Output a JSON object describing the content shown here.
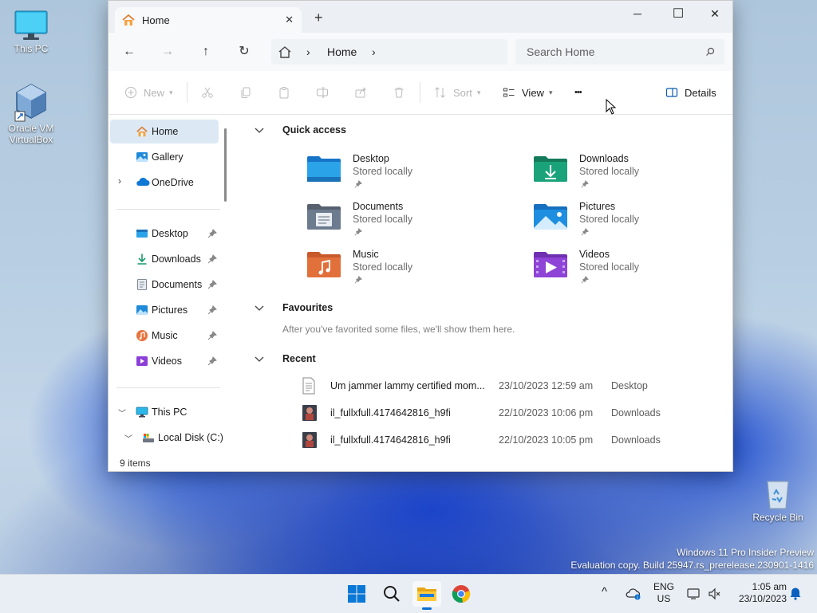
{
  "desktop": {
    "icons": [
      {
        "label": "This PC"
      },
      {
        "label": "Oracle VM VirtualBox"
      },
      {
        "label": "Recycle Bin"
      }
    ],
    "watermark": {
      "line1": "Windows 11 Pro Insider Preview",
      "line2": "Evaluation copy. Build 25947.rs_prerelease.230901-1416"
    }
  },
  "window": {
    "tab": {
      "title": "Home",
      "close": "✕"
    },
    "new_tab": "+",
    "controls": {
      "minimize": "─",
      "maximize": "☐",
      "close": "✕"
    },
    "nav": {
      "back": "←",
      "forward": "→",
      "up": "↑",
      "refresh": "↻"
    },
    "breadcrumb": {
      "home_icon": "home-icon",
      "separator": "›",
      "current": "Home"
    },
    "search": {
      "placeholder": "Search Home"
    },
    "toolbar": {
      "new": "New",
      "sort": "Sort",
      "view": "View",
      "more": "•••",
      "details": "Details"
    },
    "sidebar": {
      "top": [
        {
          "label": "Home",
          "icon": "home-icon",
          "selected": true
        },
        {
          "label": "Gallery",
          "icon": "gallery-icon"
        },
        {
          "label": "OneDrive",
          "icon": "cloud-icon"
        }
      ],
      "pinned": [
        {
          "label": "Desktop",
          "icon": "desktop-folder-icon"
        },
        {
          "label": "Downloads",
          "icon": "download-icon"
        },
        {
          "label": "Documents",
          "icon": "document-icon"
        },
        {
          "label": "Pictures",
          "icon": "pictures-icon"
        },
        {
          "label": "Music",
          "icon": "music-icon"
        },
        {
          "label": "Videos",
          "icon": "videos-icon"
        }
      ],
      "this_pc": "This PC",
      "local_disk": "Local Disk (C:)"
    },
    "quick_access": {
      "heading": "Quick access",
      "items": [
        {
          "name": "Desktop",
          "sub": "Stored locally",
          "color": "#1a86d9"
        },
        {
          "name": "Downloads",
          "sub": "Stored locally",
          "color": "#1aa37a"
        },
        {
          "name": "Documents",
          "sub": "Stored locally",
          "color": "#6d7b8f"
        },
        {
          "name": "Pictures",
          "sub": "Stored locally",
          "color": "#1e8fe0"
        },
        {
          "name": "Music",
          "sub": "Stored locally",
          "color": "#e2703a"
        },
        {
          "name": "Videos",
          "sub": "Stored locally",
          "color": "#8e44d6"
        }
      ]
    },
    "favourites": {
      "heading": "Favourites",
      "message": "After you've favorited some files, we'll show them here."
    },
    "recent": {
      "heading": "Recent",
      "items": [
        {
          "name": "Um jammer lammy certified mom...",
          "date": "23/10/2023 12:59 am",
          "location": "Desktop",
          "icon": "text-file-icon"
        },
        {
          "name": "il_fullxfull.4174642816_h9fi",
          "date": "22/10/2023 10:06 pm",
          "location": "Downloads",
          "icon": "image-file-icon"
        },
        {
          "name": "il_fullxfull.4174642816_h9fi",
          "date": "22/10/2023 10:05 pm",
          "location": "Downloads",
          "icon": "image-file-icon"
        }
      ]
    },
    "status": "9 items"
  },
  "taskbar": {
    "tray": {
      "lang_line1": "ENG",
      "lang_line2": "US",
      "time": "1:05 am",
      "date": "23/10/2023",
      "chevron": "^"
    }
  }
}
